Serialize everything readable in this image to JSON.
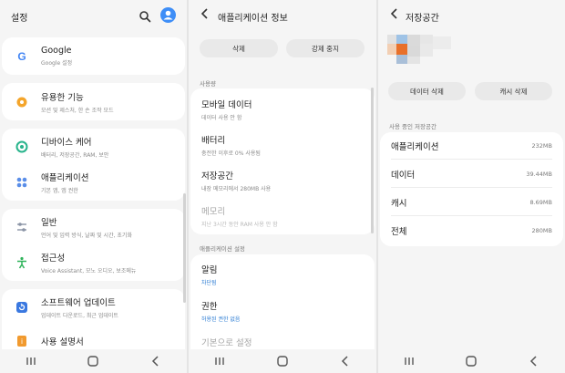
{
  "settings": {
    "title": "설정",
    "groups": [
      [
        {
          "title": "Google",
          "subtitle": "Google 설정",
          "icon": "google-icon",
          "color": "#4285f4"
        }
      ],
      [
        {
          "title": "유용한 기능",
          "subtitle": "모션 및 제스처, 한 손 조작 모드",
          "icon": "gear-star-icon",
          "color": "#f4a52b"
        }
      ],
      [
        {
          "title": "디바이스 케어",
          "subtitle": "배터리, 저장공간, RAM, 보안",
          "icon": "device-care-icon",
          "color": "#28b48c"
        },
        {
          "title": "애플리케이션",
          "subtitle": "기본 앱, 앱 권한",
          "icon": "apps-icon",
          "color": "#5a8ee8"
        }
      ],
      [
        {
          "title": "일반",
          "subtitle": "언어 및 입력 방식, 날짜 및 시간, 초기화",
          "icon": "sliders-icon",
          "color": "#8a93a5"
        },
        {
          "title": "접근성",
          "subtitle": "Voice Assistant, 모노 오디오, 보조메뉴",
          "icon": "accessibility-icon",
          "color": "#2fb35a"
        }
      ],
      [
        {
          "title": "소프트웨어 업데이트",
          "subtitle": "업데이트 다운로드, 최근 업데이트",
          "icon": "update-icon",
          "color": "#3a78e0"
        },
        {
          "title": "사용 설명서",
          "subtitle": "",
          "icon": "manual-icon",
          "color": "#f19a2f"
        }
      ]
    ]
  },
  "app_info": {
    "title": "애플리케이션 정보",
    "buttons": [
      "삭제",
      "강제 중지"
    ],
    "section_usage": "사용량",
    "usage_items": [
      {
        "title": "모바일 데이터",
        "subtitle": "데이터 사용 안 함"
      },
      {
        "title": "배터리",
        "subtitle": "충전한 이후로 0% 사용됨"
      },
      {
        "title": "저장공간",
        "subtitle": "내장 메모리에서 280MB 사용"
      },
      {
        "title": "메모리",
        "subtitle": "지난 3시간 동안 RAM 사용 안 함"
      }
    ],
    "section_settings": "애플리케이션 설정",
    "settings_items": [
      {
        "title": "알림",
        "subtitle": "차단됨"
      },
      {
        "title": "권한",
        "subtitle": "허용된 권한 없음"
      },
      {
        "title": "기본으로 설정",
        "subtitle": ""
      }
    ]
  },
  "storage": {
    "title": "저장공간",
    "buttons": [
      "데이터 삭제",
      "캐시 삭제"
    ],
    "section_label": "사용 중인 저장공간",
    "rows": [
      {
        "label": "애플리케이션",
        "value": "232MB"
      },
      {
        "label": "데이터",
        "value": "39.44MB"
      },
      {
        "label": "캐시",
        "value": "8.69MB"
      },
      {
        "label": "전체",
        "value": "280MB"
      }
    ]
  },
  "colors": {
    "accent": "#3e8ef7",
    "link": "#2a7bd3"
  }
}
